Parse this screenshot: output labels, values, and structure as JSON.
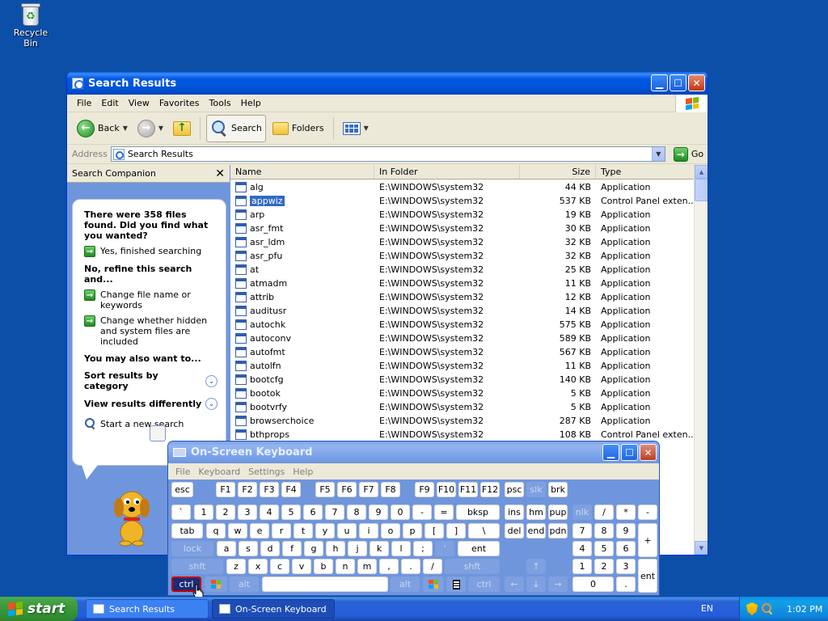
{
  "desktop": {
    "recycle_bin_label": "Recycle Bin"
  },
  "explorer": {
    "title": "Search Results",
    "menu": [
      "File",
      "Edit",
      "View",
      "Favorites",
      "Tools",
      "Help"
    ],
    "toolbar": {
      "back": "Back",
      "search": "Search",
      "folders": "Folders"
    },
    "address": {
      "label": "Address",
      "value": "Search Results",
      "go": "Go"
    },
    "companion": {
      "title": "Search Companion",
      "question": "There were 358 files found. Did you find what you wanted?",
      "option_finished": "Yes, finished searching",
      "refine_heading": "No, refine this search and...",
      "option_change_name": "Change file name or keywords",
      "option_change_hidden": "Change whether hidden and system files are included",
      "also_heading": "You may also want to...",
      "sort_results": "Sort results by category",
      "view_results": "View results differently",
      "new_search": "Start a new search"
    },
    "columns": {
      "name": "Name",
      "folder": "In Folder",
      "size": "Size",
      "type": "Type"
    },
    "files": [
      {
        "name": "alg",
        "folder": "E:\\WINDOWS\\system32",
        "size": "44 KB",
        "type": "Application"
      },
      {
        "name": "appwiz",
        "folder": "E:\\WINDOWS\\system32",
        "size": "537 KB",
        "type": "Control Panel exten..."
      },
      {
        "name": "arp",
        "folder": "E:\\WINDOWS\\system32",
        "size": "19 KB",
        "type": "Application"
      },
      {
        "name": "asr_fmt",
        "folder": "E:\\WINDOWS\\system32",
        "size": "30 KB",
        "type": "Application"
      },
      {
        "name": "asr_ldm",
        "folder": "E:\\WINDOWS\\system32",
        "size": "32 KB",
        "type": "Application"
      },
      {
        "name": "asr_pfu",
        "folder": "E:\\WINDOWS\\system32",
        "size": "32 KB",
        "type": "Application"
      },
      {
        "name": "at",
        "folder": "E:\\WINDOWS\\system32",
        "size": "25 KB",
        "type": "Application"
      },
      {
        "name": "atmadm",
        "folder": "E:\\WINDOWS\\system32",
        "size": "11 KB",
        "type": "Application"
      },
      {
        "name": "attrib",
        "folder": "E:\\WINDOWS\\system32",
        "size": "12 KB",
        "type": "Application"
      },
      {
        "name": "auditusr",
        "folder": "E:\\WINDOWS\\system32",
        "size": "14 KB",
        "type": "Application"
      },
      {
        "name": "autochk",
        "folder": "E:\\WINDOWS\\system32",
        "size": "575 KB",
        "type": "Application"
      },
      {
        "name": "autoconv",
        "folder": "E:\\WINDOWS\\system32",
        "size": "589 KB",
        "type": "Application"
      },
      {
        "name": "autofmt",
        "folder": "E:\\WINDOWS\\system32",
        "size": "567 KB",
        "type": "Application"
      },
      {
        "name": "autolfn",
        "folder": "E:\\WINDOWS\\system32",
        "size": "11 KB",
        "type": "Application"
      },
      {
        "name": "bootcfg",
        "folder": "E:\\WINDOWS\\system32",
        "size": "140 KB",
        "type": "Application"
      },
      {
        "name": "bootok",
        "folder": "E:\\WINDOWS\\system32",
        "size": "5 KB",
        "type": "Application"
      },
      {
        "name": "bootvrfy",
        "folder": "E:\\WINDOWS\\system32",
        "size": "5 KB",
        "type": "Application"
      },
      {
        "name": "browserchoice",
        "folder": "E:\\WINDOWS\\system32",
        "size": "287 KB",
        "type": "Application"
      },
      {
        "name": "bthprops",
        "folder": "E:\\WINDOWS\\system32",
        "size": "108 KB",
        "type": "Control Panel exten..."
      }
    ]
  },
  "osk": {
    "title": "On-Screen Keyboard",
    "menu": [
      "File",
      "Keyboard",
      "Settings",
      "Help"
    ],
    "keys": {
      "esc": "esc",
      "f1": "F1",
      "f2": "F2",
      "f3": "F3",
      "f4": "F4",
      "f5": "F5",
      "f6": "F6",
      "f7": "F7",
      "f8": "F8",
      "f9": "F9",
      "f10": "F10",
      "f11": "F11",
      "f12": "F12",
      "psc": "psc",
      "slk": "slk",
      "brk": "brk",
      "backtick": "`",
      "n1": "1",
      "n2": "2",
      "n3": "3",
      "n4": "4",
      "n5": "5",
      "n6": "6",
      "n7": "7",
      "n8": "8",
      "n9": "9",
      "n0": "0",
      "minus": "-",
      "equals": "=",
      "bksp": "bksp",
      "ins": "ins",
      "hm": "hm",
      "pup": "pup",
      "nlk": "nlk",
      "div": "/",
      "mul": "*",
      "sub": "-",
      "tab": "tab",
      "q": "q",
      "w": "w",
      "e": "e",
      "r": "r",
      "t": "t",
      "y": "y",
      "u": "u",
      "i": "i",
      "o": "o",
      "p": "p",
      "lbr": "[",
      "rbr": "]",
      "bslash": "\\",
      "del": "del",
      "end": "end",
      "pdn": "pdn",
      "np7": "7",
      "np8": "8",
      "np9": "9",
      "plus": "+",
      "lock": "lock",
      "a": "a",
      "s": "s",
      "d": "d",
      "f": "f",
      "g": "g",
      "h": "h",
      "j": "j",
      "k": "k",
      "l": "l",
      "semi": ";",
      "quote": "'",
      "ent": "ent",
      "np4": "4",
      "np5": "5",
      "np6": "6",
      "shft": "shft",
      "z": "z",
      "x": "x",
      "c": "c",
      "v": "v",
      "b": "b",
      "n": "n",
      "m": "m",
      "comma": ",",
      "period": ".",
      "slash": "/",
      "up": "↑",
      "np1": "1",
      "np2": "2",
      "np3": "3",
      "npent": "ent",
      "ctrl": "ctrl",
      "alt": "alt",
      "left": "←",
      "down": "↓",
      "right": "→",
      "np0": "0",
      "npdot": "."
    }
  },
  "taskbar": {
    "start": "start",
    "task_search": "Search Results",
    "task_osk": "On-Screen Keyboard",
    "lang": "EN",
    "clock": "1:02 PM"
  },
  "colors": {
    "flag_red": "#f25022",
    "flag_green": "#7fba00",
    "flag_blue": "#00a4ef",
    "flag_yellow": "#ffb900"
  }
}
